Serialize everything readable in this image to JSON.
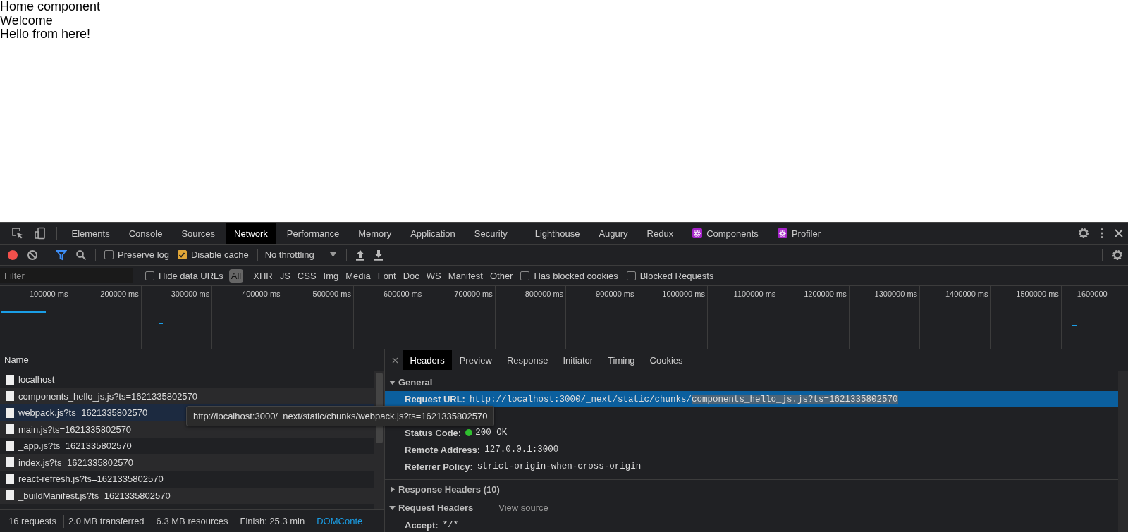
{
  "page": {
    "lines": [
      "Home component",
      "Welcome",
      "Hello from here!"
    ]
  },
  "devtools": {
    "tabs": [
      {
        "label": "Elements",
        "selected": false,
        "kind": "plain"
      },
      {
        "label": "Console",
        "selected": false,
        "kind": "plain"
      },
      {
        "label": "Sources",
        "selected": false,
        "kind": "plain"
      },
      {
        "label": "Network",
        "selected": true,
        "kind": "plain"
      },
      {
        "label": "Performance",
        "selected": false,
        "kind": "plain"
      },
      {
        "label": "Memory",
        "selected": false,
        "kind": "plain"
      },
      {
        "label": "Application",
        "selected": false,
        "kind": "plain"
      },
      {
        "label": "Security",
        "selected": false,
        "kind": "plain"
      },
      {
        "label": "Lighthouse",
        "selected": false,
        "kind": "plain"
      },
      {
        "label": "Augury",
        "selected": false,
        "kind": "plain"
      },
      {
        "label": "Redux",
        "selected": false,
        "kind": "plain"
      },
      {
        "label": "Components",
        "selected": false,
        "kind": "react"
      },
      {
        "label": "Profiler",
        "selected": false,
        "kind": "react"
      }
    ],
    "toolbar": {
      "recording": true,
      "preserve_log": {
        "label": "Preserve log",
        "checked": false
      },
      "disable_cache": {
        "label": "Disable cache",
        "checked": true
      },
      "throttling": "No throttling"
    },
    "filter_bar": {
      "placeholder": "Filter",
      "hide_data_urls": {
        "label": "Hide data URLs",
        "checked": false
      },
      "types": [
        {
          "label": "All",
          "selected": true
        },
        {
          "label": "XHR",
          "selected": false
        },
        {
          "label": "JS",
          "selected": false
        },
        {
          "label": "CSS",
          "selected": false
        },
        {
          "label": "Img",
          "selected": false
        },
        {
          "label": "Media",
          "selected": false
        },
        {
          "label": "Font",
          "selected": false
        },
        {
          "label": "Doc",
          "selected": false
        },
        {
          "label": "WS",
          "selected": false
        },
        {
          "label": "Manifest",
          "selected": false
        },
        {
          "label": "Other",
          "selected": false
        }
      ],
      "has_blocked_cookies": {
        "label": "Has blocked cookies",
        "checked": false
      },
      "blocked_requests": {
        "label": "Blocked Requests",
        "checked": false
      }
    },
    "overview_ticks": [
      "100000 ms",
      "200000 ms",
      "300000 ms",
      "400000 ms",
      "500000 ms",
      "600000 ms",
      "700000 ms",
      "800000 ms",
      "900000 ms",
      "1000000 ms",
      "1100000 ms",
      "1200000 ms",
      "1300000 ms",
      "1400000 ms",
      "1500000 ms",
      "1600000"
    ],
    "requests": {
      "column": "Name",
      "rows": [
        {
          "name": "localhost",
          "selected": false
        },
        {
          "name": "components_hello_js.js?ts=1621335802570",
          "selected": false
        },
        {
          "name": "webpack.js?ts=1621335802570",
          "selected": true
        },
        {
          "name": "main.js?ts=1621335802570",
          "selected": false
        },
        {
          "name": "_app.js?ts=1621335802570",
          "selected": false
        },
        {
          "name": "index.js?ts=1621335802570",
          "selected": false
        },
        {
          "name": "react-refresh.js?ts=1621335802570",
          "selected": false
        },
        {
          "name": "_buildManifest.js?ts=1621335802570",
          "selected": false
        }
      ],
      "tooltip": "http://localhost:3000/_next/static/chunks/webpack.js?ts=1621335802570"
    },
    "status_bar": [
      "16 requests",
      "2.0 MB transferred",
      "6.3 MB resources",
      "Finish: 25.3 min"
    ],
    "status_link": "DOMConte",
    "detail": {
      "tabs": [
        {
          "label": "Headers",
          "selected": true
        },
        {
          "label": "Preview",
          "selected": false
        },
        {
          "label": "Response",
          "selected": false
        },
        {
          "label": "Initiator",
          "selected": false
        },
        {
          "label": "Timing",
          "selected": false
        },
        {
          "label": "Cookies",
          "selected": false
        }
      ],
      "general": {
        "title": "General",
        "expanded": true,
        "request_url": {
          "key": "Request URL:",
          "prefix": "http://localhost:3000/_next/static/chunks/",
          "highlighted": "components_hello_js.js?ts=1621335802570"
        },
        "fields": [
          {
            "key": "Status Code:",
            "value": "200 OK",
            "kind": "status",
            "color": "#2fbf2f"
          },
          {
            "key": "Remote Address:",
            "value": "127.0.0.1:3000",
            "kind": "plain"
          },
          {
            "key": "Referrer Policy:",
            "value": "strict-origin-when-cross-origin",
            "kind": "plain"
          }
        ]
      },
      "response_headers": {
        "title": "Response Headers (10)",
        "expanded": false
      },
      "request_headers": {
        "title": "Request Headers",
        "expanded": true,
        "view_source": "View source",
        "fields": [
          {
            "key": "Accept:",
            "value": "*/*"
          }
        ]
      }
    }
  }
}
